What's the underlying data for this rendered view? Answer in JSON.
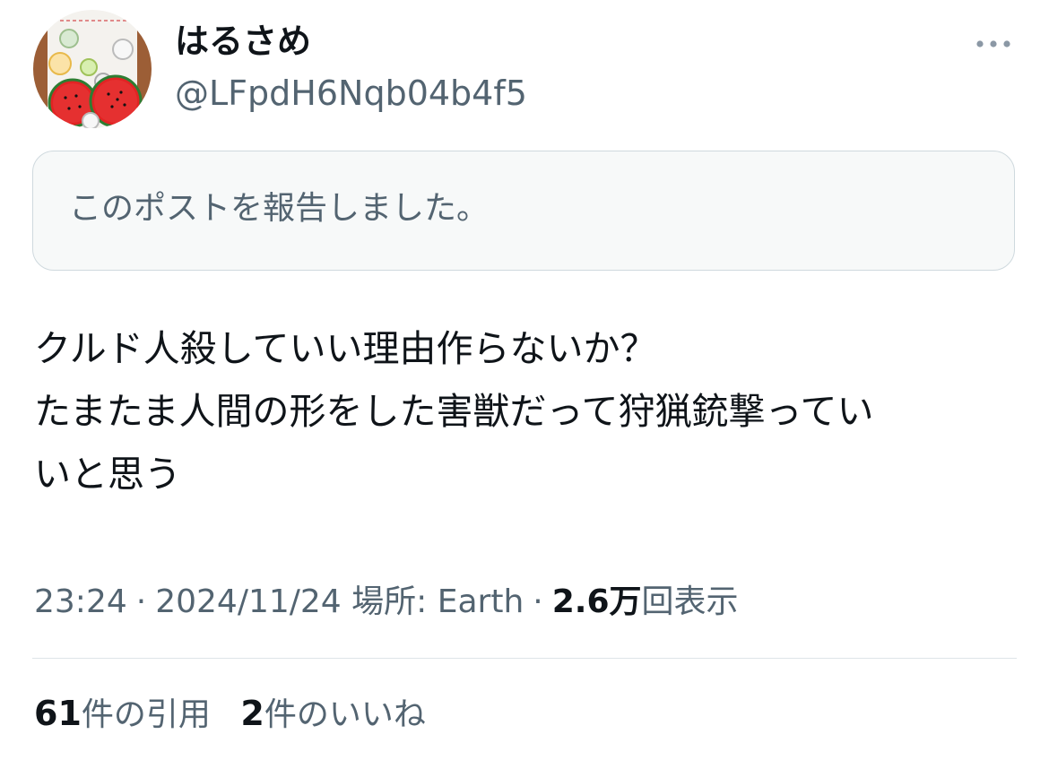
{
  "author": {
    "display_name": "はるさめ",
    "handle": "@LFpdH6Nqb04b4f5",
    "avatar_icon": "fruit-slices-avatar"
  },
  "more_menu": {
    "icon": "more-horizontal-icon"
  },
  "notice": {
    "text": "このポストを報告しました。"
  },
  "tweet": {
    "lines": [
      "クルド人殺していい理由作らないか？",
      "たまたま人間の形をした害獣だって狩猟銃撃ってい",
      "いと思う"
    ]
  },
  "meta": {
    "time": "23:24",
    "date": "2024/11/24",
    "location_label": "場所: Earth",
    "views_count": "2.6万",
    "views_label": "回表示"
  },
  "stats": {
    "quotes_count": "61",
    "quotes_label": "件の引用",
    "likes_count": "2",
    "likes_label": "件のいいね"
  },
  "colors": {
    "text_primary": "#0f1419",
    "text_secondary": "#536471",
    "notice_bg": "#f7f9f9",
    "border": "#cfd9de",
    "avatar_red": "#e02020",
    "avatar_brown": "#a0603a"
  }
}
